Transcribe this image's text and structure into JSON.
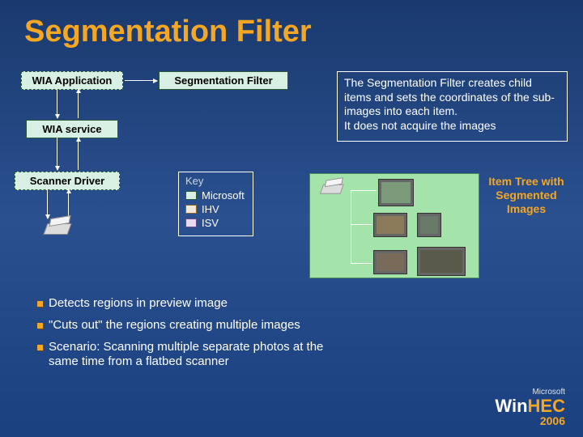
{
  "title": "Segmentation Filter",
  "boxes": {
    "wia_app": "WIA Application",
    "seg_filter": "Segmentation Filter",
    "wia_service": "WIA service",
    "scanner_driver": "Scanner Driver"
  },
  "description": {
    "line1": "The Segmentation Filter creates child items and sets the coordinates of the sub-images into each item.",
    "line2": "It does not acquire the images"
  },
  "key": {
    "title": "Key",
    "microsoft": "Microsoft",
    "ihv": "IHV",
    "isv": "ISV"
  },
  "tree_title": "Item Tree with Segmented Images",
  "bullets": {
    "b1": "Detects regions in preview image",
    "b2": "\"Cuts out\" the regions creating multiple images",
    "b3": "Scenario:  Scanning multiple separate photos at the same time from a flatbed scanner"
  },
  "logo": {
    "brand": "Microsoft",
    "product_prefix": "Win",
    "product_suffix": "HEC",
    "year": "2006"
  }
}
